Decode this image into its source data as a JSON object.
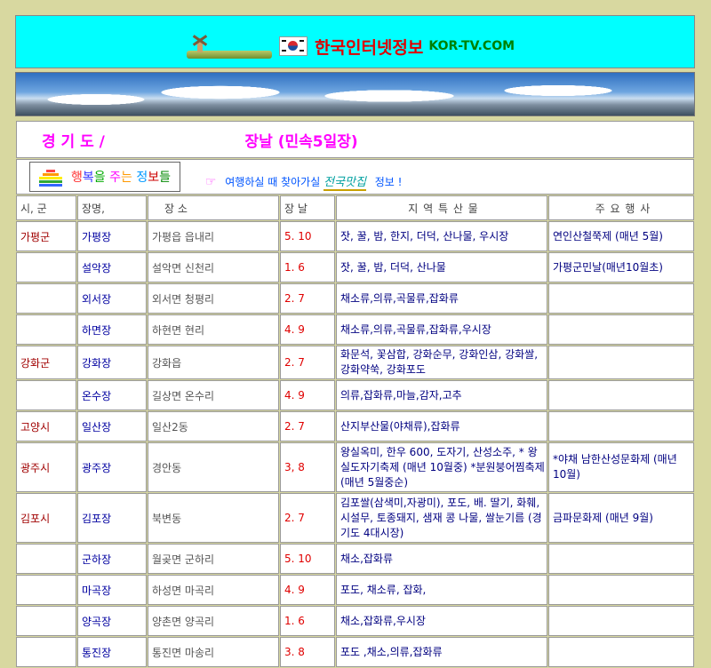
{
  "header": {
    "site_name": "한국인터넷정보",
    "site_url": "KOR-TV.COM",
    "colors": {
      "header_bg": "#00ffff",
      "title": "#e00000",
      "url": "#008000"
    }
  },
  "page": {
    "region_title": "경 기 도 /",
    "market_title": "장날 (민속5일장)"
  },
  "promo": {
    "segments": [
      {
        "text": "행",
        "color": "#ff3333"
      },
      {
        "text": "복",
        "color": "#3333ff"
      },
      {
        "text": "을",
        "color": "#00aa00"
      },
      {
        "text": " 주",
        "color": "#ff00ff"
      },
      {
        "text": "는",
        "color": "#ff9900"
      },
      {
        "text": " 정",
        "color": "#0099ff"
      },
      {
        "text": "보",
        "color": "#cc0000"
      },
      {
        "text": "들",
        "color": "#008800"
      }
    ],
    "hand_icon": "☞",
    "note": "여행하실 때 찾아가실",
    "note_emph": "전국맛집",
    "note_tail": "정보 !"
  },
  "table": {
    "headers": [
      "시, 군",
      "장명,",
      "장 소",
      "장 날",
      "지 역 특 산 물",
      "주 요 행 사"
    ],
    "rows": [
      {
        "city": "가평군",
        "name": "가평장",
        "location": "가평읍 읍내리",
        "days": "5. 10",
        "products": "잣, 꿀, 밤, 한지, 더덕, 산나물, 우시장",
        "events": "연인산철쭉제 (매년 5월)"
      },
      {
        "city": "",
        "name": "설악장",
        "location": "설악면 신천리",
        "days": "1. 6",
        "products": "잣, 꿀, 밤, 더덕, 산나물",
        "events": "가평군민날(매년10월초)"
      },
      {
        "city": "",
        "name": "외서장",
        "location": "외서면 청평리",
        "days": "2. 7",
        "products": "채소류,의류,곡물류,잡화류",
        "events": ""
      },
      {
        "city": "",
        "name": "하면장",
        "location": "하현면 현리",
        "days": "4. 9",
        "products": "채소류,의류,곡물류,잡화류,우시장",
        "events": ""
      },
      {
        "city": "강화군",
        "name": "강화장",
        "location": "강화읍",
        "days": "2. 7",
        "products": "화문석, 꽃삼합, 강화순무, 강화인삼, 강화쌀, 강화약쑥, 강화포도",
        "events": ""
      },
      {
        "city": "",
        "name": "온수장",
        "location": "길상면 온수리",
        "days": "4. 9",
        "products": "의류,잡화류,마늘,감자,고추",
        "events": ""
      },
      {
        "city": "고양시",
        "name": "일산장",
        "location": "일산2동",
        "days": "2. 7",
        "products": "산지부산물(야채류),잡화류",
        "events": ""
      },
      {
        "city": "광주시",
        "name": "광주장",
        "location": "경안동",
        "days": "3, 8",
        "products": "왕실옥미, 한우 600, 도자기, 산성소주, * 왕실도자기축제 (매년 10월중) *분원붕어찜축제(매년 5월중순)",
        "events": "*야채 남한산성문화제 (매년 10월)"
      },
      {
        "city": "김포시",
        "name": "김포장",
        "location": "북변동",
        "days": "2. 7",
        "products": "김포쌀(삼색미,자광미), 포도, 배. 딸기, 화훼, 시설무, 토종돼지, 샘재 콩 나물, 쌀눈기름 (경기도 4대시장)",
        "events": "금파문화제 (매년 9월)"
      },
      {
        "city": "",
        "name": "군하장",
        "location": "월곶면 군하리",
        "days": "5. 10",
        "products": "채소,잡화류",
        "events": ""
      },
      {
        "city": "",
        "name": "마곡장",
        "location": "하성면 마곡리",
        "days": "4. 9",
        "products": "포도, 채소류, 잡화,",
        "events": ""
      },
      {
        "city": "",
        "name": "양곡장",
        "location": "양촌면 양곡리",
        "days": "1. 6",
        "products": "채소,잡화류,우시장",
        "events": ""
      },
      {
        "city": "",
        "name": "통진장",
        "location": "통진면 마송리",
        "days": "3. 8",
        "products": "포도 ,채소,의류,잡화류",
        "events": ""
      }
    ]
  }
}
